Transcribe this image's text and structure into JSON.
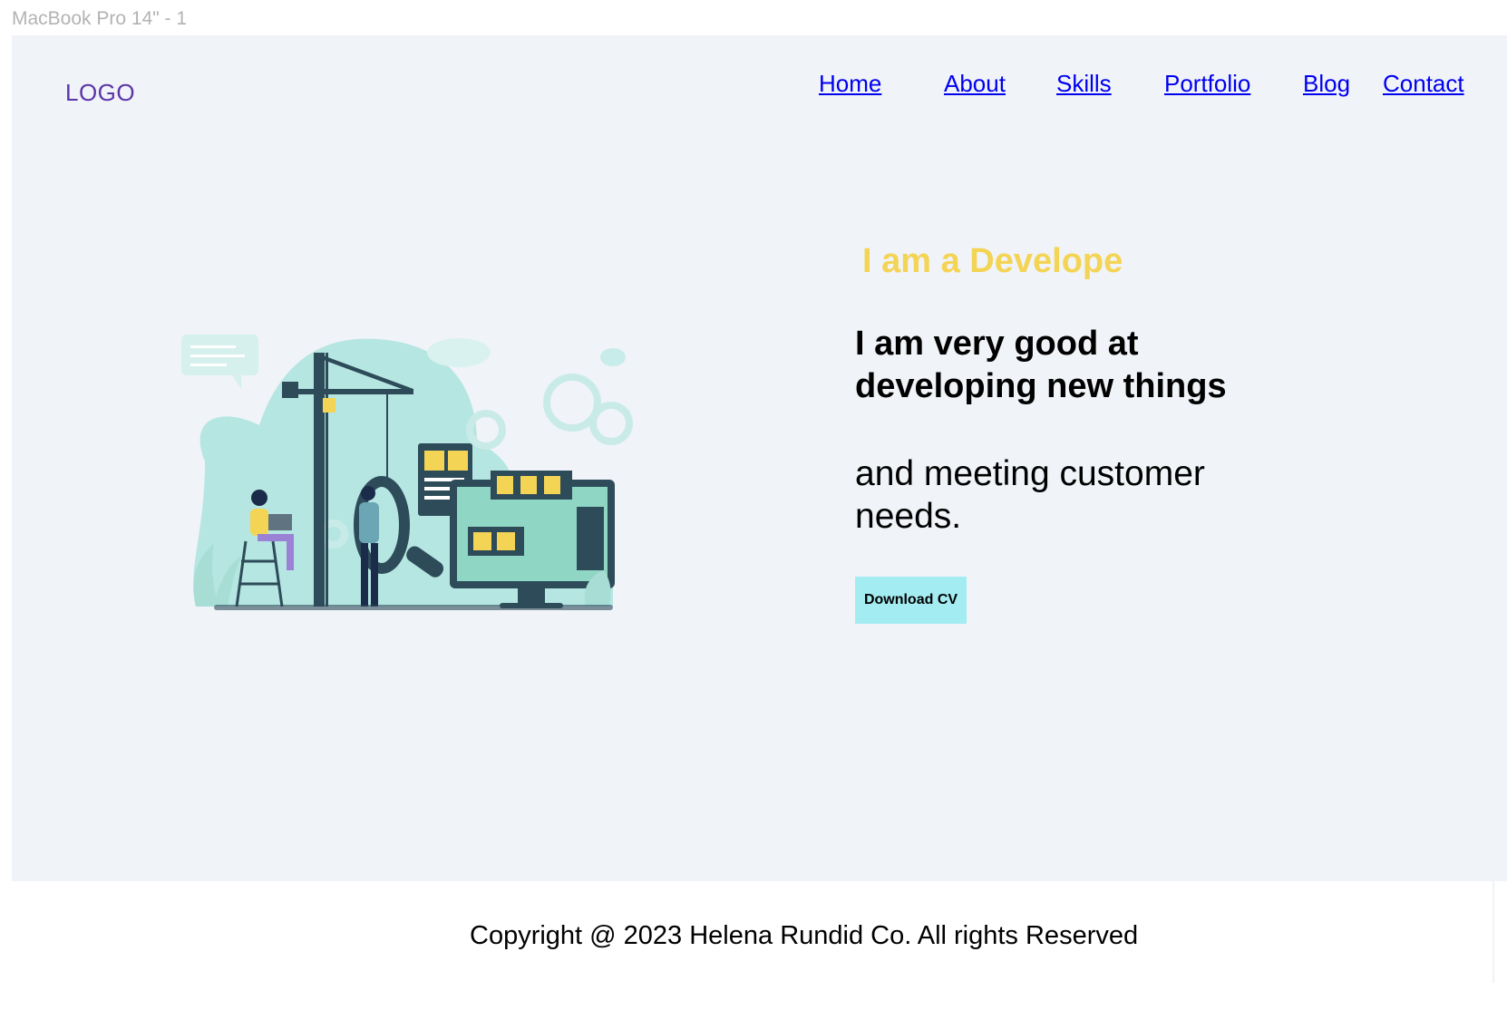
{
  "frame": {
    "label": "MacBook Pro 14\" - 1"
  },
  "header": {
    "logo": "LOGO",
    "nav": [
      {
        "label": "Home",
        "active": true
      },
      {
        "label": "About"
      },
      {
        "label": "Skills"
      },
      {
        "label": "Portfolio"
      },
      {
        "label": "Blog"
      },
      {
        "label": "Contact"
      }
    ]
  },
  "hero": {
    "kicker": "I am a Develope",
    "headline": "I am very good at developing new things",
    "subtext": "and meeting customer needs.",
    "cta_label": "Download CV"
  },
  "footer": {
    "copyright": "Copyright @ 2023 Helena Rundid Co. All rights Reserved"
  },
  "colors": {
    "page_bg": "#f0f3f8",
    "nav_text": "#5b35a8",
    "kicker": "#f4d454",
    "cta_bg": "#a3ecf1",
    "illustration_teal": "#b5e6e1",
    "illustration_dark": "#2e4b5a"
  }
}
